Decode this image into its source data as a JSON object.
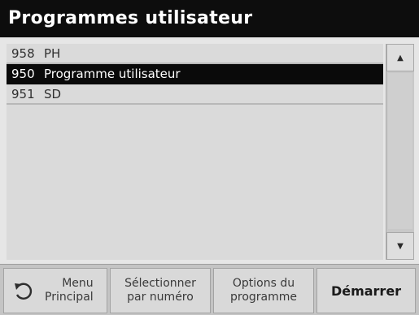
{
  "header": {
    "title": "Programmes utilisateur"
  },
  "programs": [
    {
      "number": "958",
      "name": "PH",
      "selected": false
    },
    {
      "number": "950",
      "name": "Programme utilisateur",
      "selected": true
    },
    {
      "number": "951",
      "name": "SD",
      "selected": false
    }
  ],
  "scrollbar": {
    "up_icon": "arrow-up-icon",
    "down_icon": "arrow-down-icon"
  },
  "toolbar": {
    "menu_line1": "Menu",
    "menu_line2": "Principal",
    "menu_icon": "back-arrow-icon",
    "select_line1": "Sélectionner",
    "select_line2": "par numéro",
    "options_line1": "Options du",
    "options_line2": "programme",
    "start_label": "Démarrer"
  },
  "colors": {
    "title_bg": "#0d0d0d",
    "selected_row_bg": "#0a0a0a",
    "background": "#e6e6e6"
  }
}
